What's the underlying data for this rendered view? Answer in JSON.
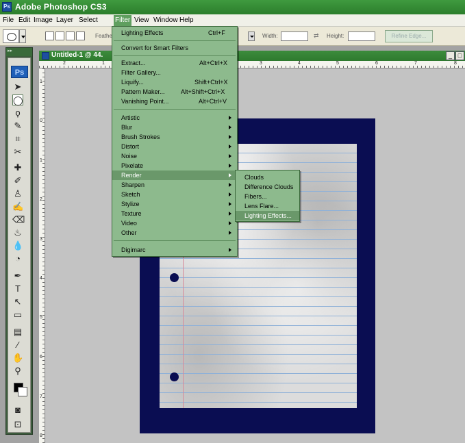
{
  "app": {
    "title": "Adobe Photoshop CS3",
    "logo": "Ps"
  },
  "menubar": [
    "File",
    "Edit",
    "Image",
    "Layer",
    "Select",
    "Filter",
    "View",
    "Window",
    "Help"
  ],
  "options": {
    "feather_label": "Feathe",
    "width_label": "Width:",
    "height_label": "Height:",
    "refine_edge": "Refine Edge..."
  },
  "toolbox": {
    "logo": "Ps"
  },
  "document": {
    "title": "Untitled-1 @ 44.",
    "ruler_h": [
      "2",
      "1",
      "3",
      "4",
      "5",
      "6",
      "7",
      "8"
    ],
    "ruler_v": [
      "1",
      "0",
      "1",
      "2",
      "3",
      "4",
      "5",
      "6",
      "7",
      "8"
    ]
  },
  "filter_menu": {
    "items": [
      {
        "label": "Lighting Effects",
        "shortcut": "Ctrl+F"
      },
      {
        "label": "Convert for Smart Filters",
        "shortcut": ""
      },
      {
        "label": "Extract...",
        "shortcut": "Alt+Ctrl+X"
      },
      {
        "label": "Filter Gallery...",
        "shortcut": ""
      },
      {
        "label": "Liquify...",
        "shortcut": "Shift+Ctrl+X"
      },
      {
        "label": "Pattern Maker...",
        "shortcut": "Alt+Shift+Ctrl+X"
      },
      {
        "label": "Vanishing Point...",
        "shortcut": "Alt+Ctrl+V"
      },
      {
        "label": "Artistic",
        "submenu": true
      },
      {
        "label": "Blur",
        "submenu": true
      },
      {
        "label": "Brush Strokes",
        "submenu": true
      },
      {
        "label": "Distort",
        "submenu": true
      },
      {
        "label": "Noise",
        "submenu": true
      },
      {
        "label": "Pixelate",
        "submenu": true
      },
      {
        "label": "Render",
        "submenu": true
      },
      {
        "label": "Sharpen",
        "submenu": true
      },
      {
        "label": "Sketch",
        "submenu": true
      },
      {
        "label": "Stylize",
        "submenu": true
      },
      {
        "label": "Texture",
        "submenu": true
      },
      {
        "label": "Video",
        "submenu": true
      },
      {
        "label": "Other",
        "submenu": true
      },
      {
        "label": "Digimarc",
        "submenu": true
      }
    ]
  },
  "render_submenu": {
    "items": [
      "Clouds",
      "Difference Clouds",
      "Fibers...",
      "Lens Flare...",
      "Lighting Effects..."
    ]
  }
}
